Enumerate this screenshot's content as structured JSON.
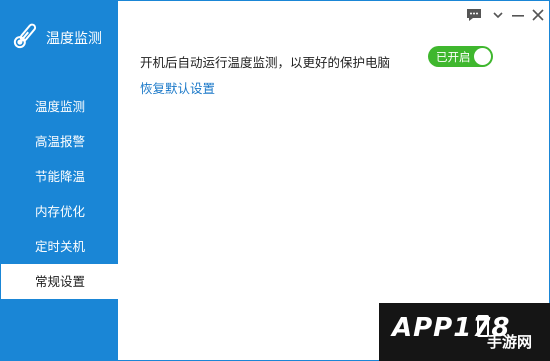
{
  "app": {
    "title": "温度监测",
    "accent_color": "#1a86d6",
    "icon": "thermometer-icon"
  },
  "window_controls": {
    "feedback_icon": "chat-icon",
    "menu_icon": "menu-icon",
    "minimize_icon": "minimize-icon",
    "close_icon": "close-icon"
  },
  "sidebar": {
    "items": [
      {
        "label": "温度监测",
        "active": false
      },
      {
        "label": "高温报警",
        "active": false
      },
      {
        "label": "节能降温",
        "active": false
      },
      {
        "label": "内存优化",
        "active": false
      },
      {
        "label": "定时关机",
        "active": false
      },
      {
        "label": "常规设置",
        "active": true
      }
    ]
  },
  "settings": {
    "autostart_text": "开机后自动运行温度监测，以更好的保护电脑",
    "toggle_label": "已开启",
    "toggle_on": true,
    "toggle_color": "#3fb72e",
    "restore_label": "恢复默认设置"
  },
  "watermark": {
    "logo": "APP178",
    "sub": "手游网"
  }
}
